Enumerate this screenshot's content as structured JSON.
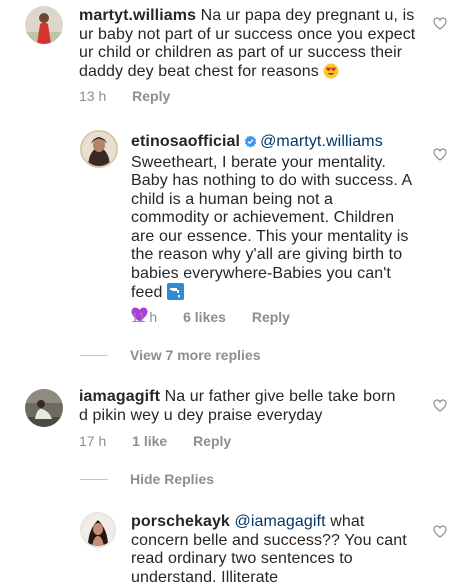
{
  "comments": [
    {
      "username": "martyt.williams",
      "text": "Na ur papa dey pregnant u, is ur baby not part of ur success once you expect ur child or children as part of ur success their daddy dey beat chest for reasons",
      "time": "13 h",
      "reply": "Reply",
      "emoji": "heart-eyes-emoji"
    },
    {
      "username": "etinosaofficial",
      "mention": "@martyt.williams",
      "text": "Sweetheart, I berate your mentality. Baby has nothing to do with success. A child is a human being not a commodity or achievement. Children are our essence. This your mentality is the reason why y'all are giving birth to babies everywhere-Babies you can't feed",
      "time": "11 h",
      "likes": "6 likes",
      "reply": "Reply",
      "emoji": "tap-water-emoji",
      "emoji2": "purple-heart-emoji"
    },
    {
      "username": "iamagagift",
      "text": "Na ur father give belle take born d pikin  wey u dey praise everyday",
      "time": "17 h",
      "likes": "1 like",
      "reply": "Reply"
    },
    {
      "username": "porschekayk",
      "mention": "@iamagagift",
      "text": "what concern belle and success?? You cant read ordinary two sentences to understand. Illiterate"
    }
  ],
  "view_more_replies": "View 7 more replies",
  "hide_replies": "Hide Replies",
  "colors": {
    "username": "#262626",
    "mention": "#00376b",
    "meta": "#8e8e8e",
    "verified": "#3897f0"
  }
}
